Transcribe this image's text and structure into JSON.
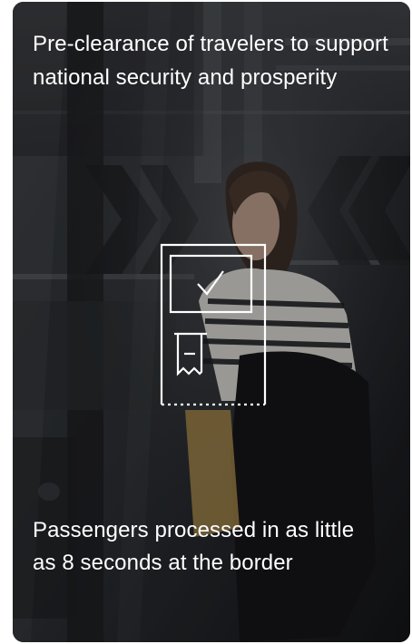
{
  "card": {
    "headline": "Pre-clearance of travelers to support national security and prosperity",
    "stat": "Passengers processed in as little as 8 seconds at the border"
  },
  "icons": {
    "background": "traveler-at-kiosk-photo",
    "main": "document-check-icon",
    "check": "checkmark-icon",
    "receipt": "receipt-icon"
  },
  "colors": {
    "text": "#ffffff",
    "overlay": "#1b1d21"
  }
}
